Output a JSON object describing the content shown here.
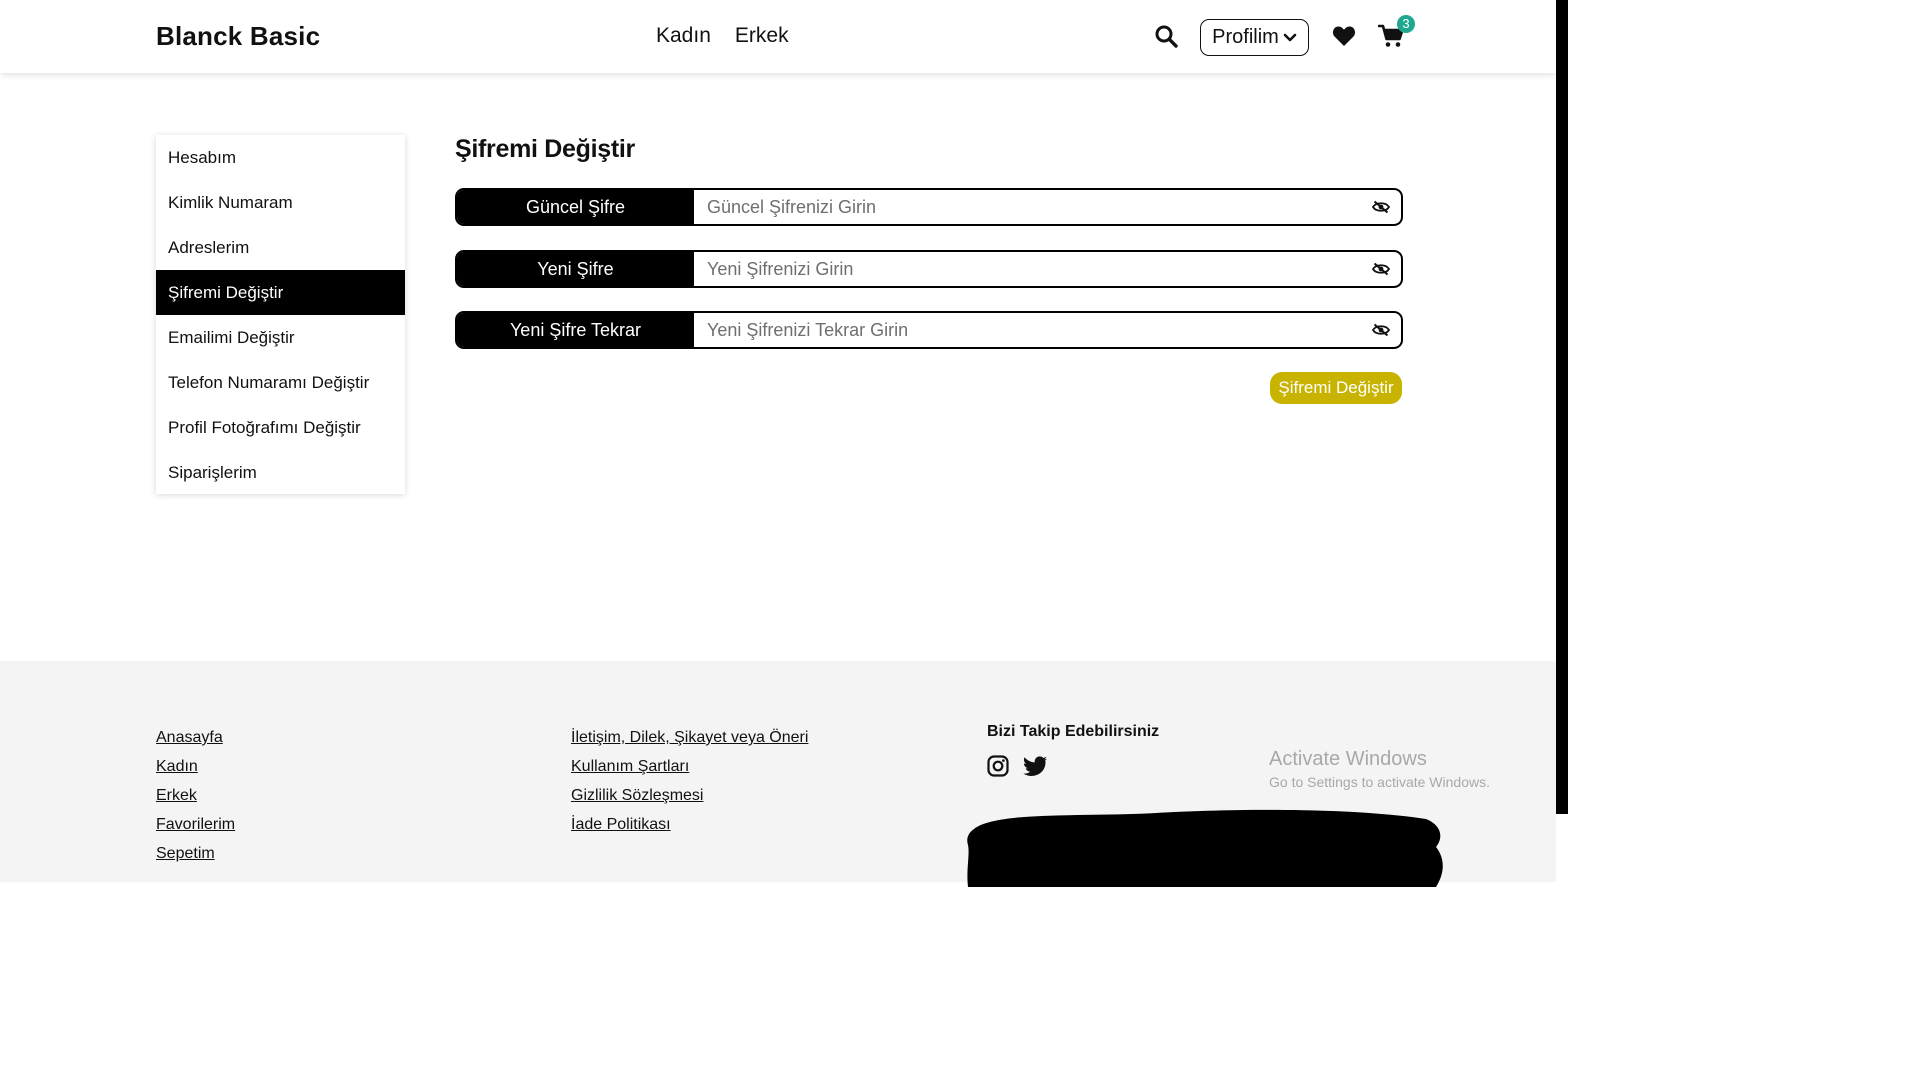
{
  "header": {
    "brand": "Blanck Basic",
    "nav": [
      "Kadın",
      "Erkek"
    ],
    "profile_label": "Profilim",
    "cart_count": "3",
    "icons": [
      "search-icon",
      "chevron-down-icon",
      "heart-icon",
      "cart-icon"
    ]
  },
  "sidebar": {
    "items": [
      {
        "label": "Hesabım"
      },
      {
        "label": "Kimlik Numaram"
      },
      {
        "label": "Adreslerim"
      },
      {
        "label": "Şifremi Değiştir",
        "active": true
      },
      {
        "label": "Emailimi Değiştir"
      },
      {
        "label": "Telefon Numaramı Değiştir"
      },
      {
        "label": "Profil Fotoğrafımı Değiştir"
      },
      {
        "label": "Siparişlerim"
      }
    ]
  },
  "main": {
    "title": "Şifremi Değiştir",
    "fields": [
      {
        "label": "Güncel Şifre",
        "placeholder": "Güncel Şifrenizi Girin",
        "value": ""
      },
      {
        "label": "Yeni Şifre",
        "placeholder": "Yeni Şifrenizi Girin",
        "value": ""
      },
      {
        "label": "Yeni Şifre Tekrar",
        "placeholder": "Yeni Şifrenizi Tekrar Girin",
        "value": ""
      }
    ],
    "submit_label": "Şifremi Değiştir"
  },
  "footer": {
    "col1": [
      "Anasayfa",
      "Kadın",
      "Erkek",
      "Favorilerim",
      "Sepetim"
    ],
    "col2": [
      "İletişim, Dilek, Şikayet veya Öneri",
      "Kullanım Şartları",
      "Gizlilik Sözleşmesi",
      "İade Politikası"
    ],
    "follow_title": "Bizi Takip Edebilirsiniz",
    "social_icons": [
      "instagram-icon",
      "twitter-icon"
    ]
  },
  "os_overlay": {
    "activate_title": "Activate Windows",
    "activate_subtitle": "Go to Settings to activate Windows."
  },
  "colors": {
    "accent": "#c8b400",
    "active_bg": "#000000",
    "badge": "#1fa88f",
    "footer_bg": "#f4f4f4"
  }
}
